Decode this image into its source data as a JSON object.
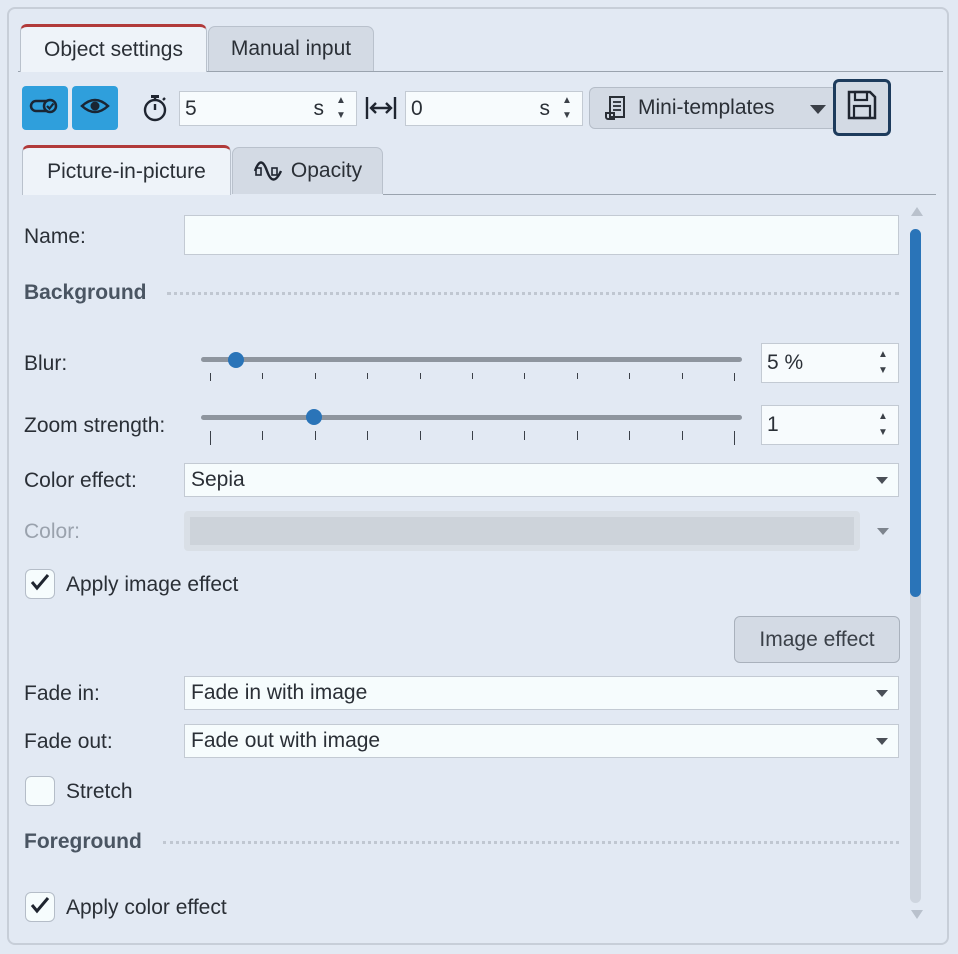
{
  "top_tabs": [
    {
      "label": "Object settings",
      "active": true
    },
    {
      "label": "Manual input",
      "active": false
    }
  ],
  "toolbar": {
    "duration_value": "5",
    "duration_unit": "s",
    "offset_value": "0",
    "offset_unit": "s",
    "mini_templates_label": "Mini-templates"
  },
  "sub_tabs": [
    {
      "label": "Picture-in-picture",
      "active": true
    },
    {
      "label": "Opacity",
      "active": false
    }
  ],
  "form": {
    "name_label": "Name:",
    "name_value": "",
    "background_heading": "Background",
    "blur_label": "Blur:",
    "blur_value": "5 %",
    "blur_level_percent": 5,
    "zoom_label": "Zoom strength:",
    "zoom_value": "1",
    "zoom_level": 1,
    "color_effect_label": "Color effect:",
    "color_effect_value": "Sepia",
    "color_label": "Color:",
    "apply_image_effect_label": "Apply image effect",
    "apply_image_effect_checked": true,
    "image_effect_button": "Image effect",
    "fade_in_label": "Fade in:",
    "fade_in_value": "Fade in with image",
    "fade_out_label": "Fade out:",
    "fade_out_value": "Fade out with image",
    "stretch_label": "Stretch",
    "stretch_checked": false,
    "foreground_heading": "Foreground",
    "apply_color_effect_label": "Apply color effect",
    "apply_color_effect_checked": true
  },
  "colors": {
    "accent": "#2f9fdc",
    "active_tab_marker": "#b13a3a",
    "slider_thumb": "#2a74b8",
    "save_border": "#1d3b5c"
  }
}
